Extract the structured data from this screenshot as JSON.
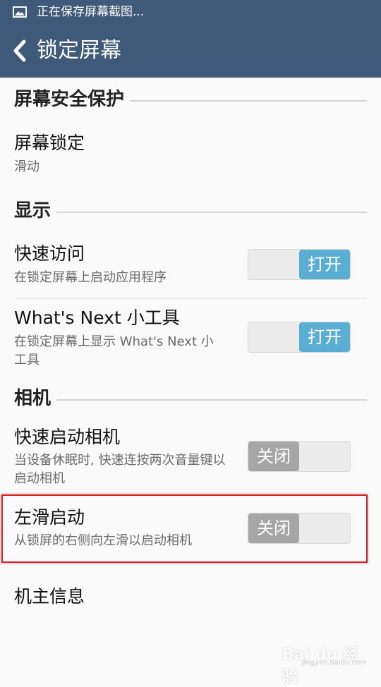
{
  "status_bar": {
    "icon": "image-icon",
    "text": "正在保存屏幕截图..."
  },
  "action_bar": {
    "back_icon": "chevron-left-icon",
    "title": "锁定屏幕"
  },
  "sections": {
    "security": {
      "label": "屏幕安全保护"
    },
    "display": {
      "label": "显示"
    },
    "camera": {
      "label": "相机"
    }
  },
  "items": {
    "screen_lock": {
      "title": "屏幕锁定",
      "summary": "滑动"
    },
    "quick_access": {
      "title": "快速访问",
      "summary": "在锁定屏幕上启动应用程序",
      "toggle": "打开",
      "state": "on"
    },
    "whats_next": {
      "title": "What's Next 小工具",
      "summary": "在锁定屏幕上显示 What's Next 小工具",
      "toggle": "打开",
      "state": "on"
    },
    "quick_camera": {
      "title": "快速启动相机",
      "summary": "当设备休眠时, 快速连按两次音量键以启动相机",
      "toggle": "关闭",
      "state": "off"
    },
    "swipe_left": {
      "title": "左滑启动",
      "summary": "从锁屏的右侧向左滑以启动相机",
      "toggle": "关闭",
      "state": "off"
    },
    "owner_info": {
      "title": "机主信息"
    }
  },
  "watermark": {
    "brand": "Bai du 经验",
    "url": "jingyan.baidu.com"
  },
  "colors": {
    "header": "#3e5a78",
    "toggle_on": "#5aaed4",
    "toggle_off": "#a6a6a6",
    "highlight": "#e02020"
  }
}
